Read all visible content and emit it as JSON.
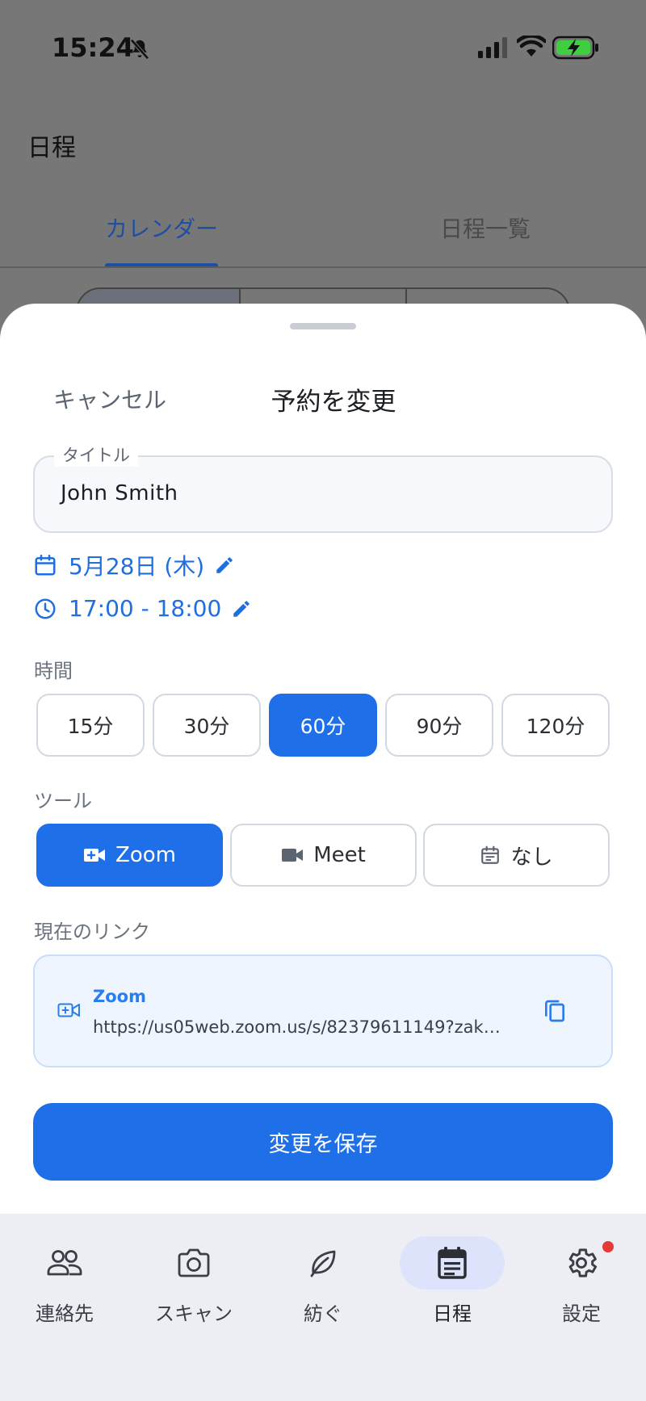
{
  "status_bar": {
    "time": "15:24"
  },
  "background": {
    "title": "日程",
    "tabs": [
      {
        "label": "カレンダー",
        "active": true
      },
      {
        "label": "日程一覧",
        "active": false
      }
    ]
  },
  "sheet": {
    "cancel_label": "キャンセル",
    "title": "予約を変更",
    "title_field": {
      "legend": "タイトル",
      "value": "John Smith"
    },
    "date_text": "5月28日 (木)",
    "time_text": "17:00 - 18:00",
    "duration": {
      "label": "時間",
      "options": [
        "15分",
        "30分",
        "60分",
        "90分",
        "120分"
      ],
      "selected": "60分"
    },
    "tool": {
      "label": "ツール",
      "options": [
        "Zoom",
        "Meet",
        "なし"
      ],
      "selected": "Zoom"
    },
    "current_link": {
      "label": "現在のリンク",
      "provider": "Zoom",
      "url": "https://us05web.zoom.us/s/82379611149?zak…"
    },
    "save_label": "変更を保存"
  },
  "bottom_nav": {
    "items": [
      {
        "label": "連絡先",
        "icon": "contacts-icon"
      },
      {
        "label": "スキャン",
        "icon": "camera-icon"
      },
      {
        "label": "紡ぐ",
        "icon": "leaf-icon"
      },
      {
        "label": "日程",
        "icon": "schedule-icon",
        "active": true
      },
      {
        "label": "設定",
        "icon": "gear-icon",
        "badge": true
      }
    ]
  },
  "colors": {
    "accent": "#1f6fe8",
    "link_text": "#1f6fe0",
    "badge": "#e53935"
  }
}
